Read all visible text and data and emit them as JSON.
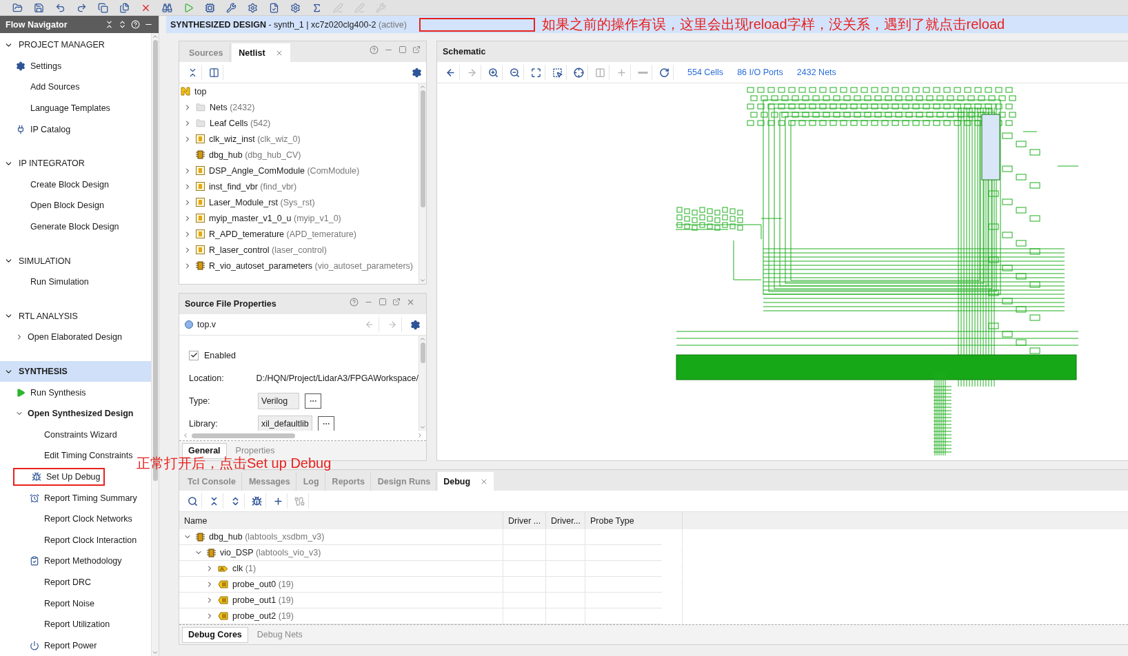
{
  "navigator": {
    "title": "Flow Navigator",
    "sections": [
      {
        "label": "PROJECT MANAGER",
        "expanded": true,
        "selected": false,
        "items": [
          {
            "label": "Settings",
            "kind": "settings"
          },
          {
            "label": "Add Sources",
            "kind": "plain"
          },
          {
            "label": "Language Templates",
            "kind": "plain"
          },
          {
            "label": "IP Catalog",
            "kind": "ip"
          }
        ]
      },
      {
        "label": "IP INTEGRATOR",
        "expanded": true,
        "selected": false,
        "items": [
          {
            "label": "Create Block Design",
            "kind": "plain"
          },
          {
            "label": "Open Block Design",
            "kind": "plain"
          },
          {
            "label": "Generate Block Design",
            "kind": "plain"
          }
        ]
      },
      {
        "label": "SIMULATION",
        "expanded": true,
        "selected": false,
        "items": [
          {
            "label": "Run Simulation",
            "kind": "plain"
          }
        ]
      },
      {
        "label": "RTL ANALYSIS",
        "expanded": true,
        "selected": false,
        "items": [
          {
            "label": "Open Elaborated Design",
            "expanded": false
          }
        ]
      },
      {
        "label": "SYNTHESIS",
        "expanded": true,
        "selected": true,
        "items": [
          {
            "label": "Run Synthesis",
            "kind": "run"
          },
          {
            "label": "Open Synthesized Design",
            "expanded": true,
            "children": [
              {
                "label": "Constraints Wizard",
                "kind": "plain"
              },
              {
                "label": "Edit Timing Constraints",
                "kind": "plain"
              },
              {
                "label": "Set Up Debug",
                "kind": "debug",
                "highlighted": true
              },
              {
                "label": "Report Timing Summary",
                "kind": "timing"
              },
              {
                "label": "Report Clock Networks",
                "kind": "plain"
              },
              {
                "label": "Report Clock Interaction",
                "kind": "plain"
              },
              {
                "label": "Report Methodology",
                "kind": "methodology"
              },
              {
                "label": "Report DRC",
                "kind": "plain"
              },
              {
                "label": "Report Noise",
                "kind": "plain"
              },
              {
                "label": "Report Utilization",
                "kind": "plain"
              },
              {
                "label": "Report Power",
                "kind": "power"
              }
            ]
          }
        ]
      }
    ]
  },
  "banner": {
    "title": "SYNTHESIZED DESIGN",
    "detail": " - synth_1 | xc7z020clg400-2",
    "status": "(active)",
    "note": "如果之前的操作有误，这里会出现reload字样，没关系，遇到了就点击reload"
  },
  "netlist": {
    "tabs": [
      {
        "label": "Sources",
        "selected": false
      },
      {
        "label": "Netlist",
        "selected": true
      }
    ],
    "tree": {
      "name": "top",
      "kind": "top",
      "children": [
        {
          "name": "Nets",
          "type": "(2432)",
          "kind": "folder",
          "expanded": false
        },
        {
          "name": "Leaf Cells",
          "type": "(542)",
          "kind": "folder",
          "expanded": false
        },
        {
          "name": "clk_wiz_inst",
          "type": "(clk_wiz_0)",
          "kind": "module",
          "expanded": false
        },
        {
          "name": "dbg_hub",
          "type": "(dbg_hub_CV)",
          "kind": "core"
        },
        {
          "name": "DSP_Angle_ComModule",
          "type": "(ComModule)",
          "kind": "module",
          "expanded": false
        },
        {
          "name": "inst_find_vbr",
          "type": "(find_vbr)",
          "kind": "module",
          "expanded": false
        },
        {
          "name": "Laser_Module_rst",
          "type": "(Sys_rst)",
          "kind": "module",
          "expanded": false
        },
        {
          "name": "myip_master_v1_0_u",
          "type": "(myip_v1_0)",
          "kind": "module",
          "expanded": false
        },
        {
          "name": "R_APD_temerature",
          "type": "(APD_temerature)",
          "kind": "module",
          "expanded": false
        },
        {
          "name": "R_laser_control",
          "type": "(laser_control)",
          "kind": "module",
          "expanded": false
        },
        {
          "name": "R_vio_autoset_parameters",
          "type": "(vio_autoset_parameters)",
          "kind": "core",
          "expanded": false
        }
      ]
    }
  },
  "properties": {
    "title": "Source File Properties",
    "file": "top.v",
    "enabled": {
      "label": "Enabled",
      "checked": true
    },
    "fields": [
      {
        "label": "Location:",
        "value": "D:/HQN/Project/LidarA3/FPGAWorkspace/",
        "kind": "text"
      },
      {
        "label": "Type:",
        "value": "Verilog",
        "kind": "select"
      },
      {
        "label": "Library:",
        "value": "xil_defaultlib",
        "kind": "select"
      }
    ],
    "tabs": [
      {
        "label": "General",
        "selected": true
      },
      {
        "label": "Properties",
        "selected": false
      }
    ]
  },
  "schematic": {
    "title": "Schematic",
    "tools": [
      {
        "kind": "back",
        "disabled": false
      },
      {
        "kind": "forward",
        "disabled": true
      },
      {
        "kind": "zoom-in",
        "disabled": false
      },
      {
        "kind": "zoom-out",
        "disabled": false
      },
      {
        "kind": "fit",
        "disabled": false
      },
      {
        "kind": "select-area",
        "disabled": false
      },
      {
        "kind": "target",
        "disabled": false
      },
      {
        "kind": "split",
        "disabled": true
      },
      {
        "kind": "plus",
        "disabled": true
      },
      {
        "kind": "minus",
        "disabled": true
      },
      {
        "kind": "refresh",
        "disabled": false
      }
    ],
    "stats": [
      "554 Cells",
      "86 I/O Ports",
      "2432 Nets"
    ]
  },
  "debug_panel": {
    "tabs": [
      {
        "label": "Tcl Console",
        "selected": false
      },
      {
        "label": "Messages",
        "selected": false
      },
      {
        "label": "Log",
        "selected": false
      },
      {
        "label": "Reports",
        "selected": false
      },
      {
        "label": "Design Runs",
        "selected": false
      },
      {
        "label": "Debug",
        "selected": true
      }
    ],
    "tools": [
      {
        "kind": "search",
        "disabled": false
      },
      {
        "kind": "collapse",
        "disabled": false
      },
      {
        "kind": "expand",
        "disabled": false
      },
      {
        "kind": "bug",
        "disabled": false
      },
      {
        "kind": "plus",
        "disabled": false
      },
      {
        "kind": "connect",
        "disabled": true
      }
    ],
    "columns": [
      "Name",
      "Driver ...",
      "Driver...",
      "Probe Type"
    ],
    "rows": [
      {
        "name": "dbg_hub",
        "type": "(labtools_xsdbm_v3)",
        "kind": "core",
        "expanded": true,
        "children": [
          {
            "name": "vio_DSP",
            "type": "(labtools_vio_v3)",
            "kind": "core",
            "expanded": true,
            "children": [
              {
                "name": "clk",
                "type": "(1)",
                "kind": "clock",
                "expanded": false
              },
              {
                "name": "probe_out0",
                "type": "(19)",
                "kind": "probe",
                "expanded": false
              },
              {
                "name": "probe_out1",
                "type": "(19)",
                "kind": "probe",
                "expanded": false
              },
              {
                "name": "probe_out2",
                "type": "(19)",
                "kind": "probe",
                "expanded": false
              }
            ]
          }
        ]
      }
    ],
    "bottom_tabs": [
      {
        "label": "Debug Cores",
        "selected": true
      },
      {
        "label": "Debug Nets",
        "selected": false
      }
    ]
  },
  "annotation": "正常打开后，点击Set up Debug"
}
